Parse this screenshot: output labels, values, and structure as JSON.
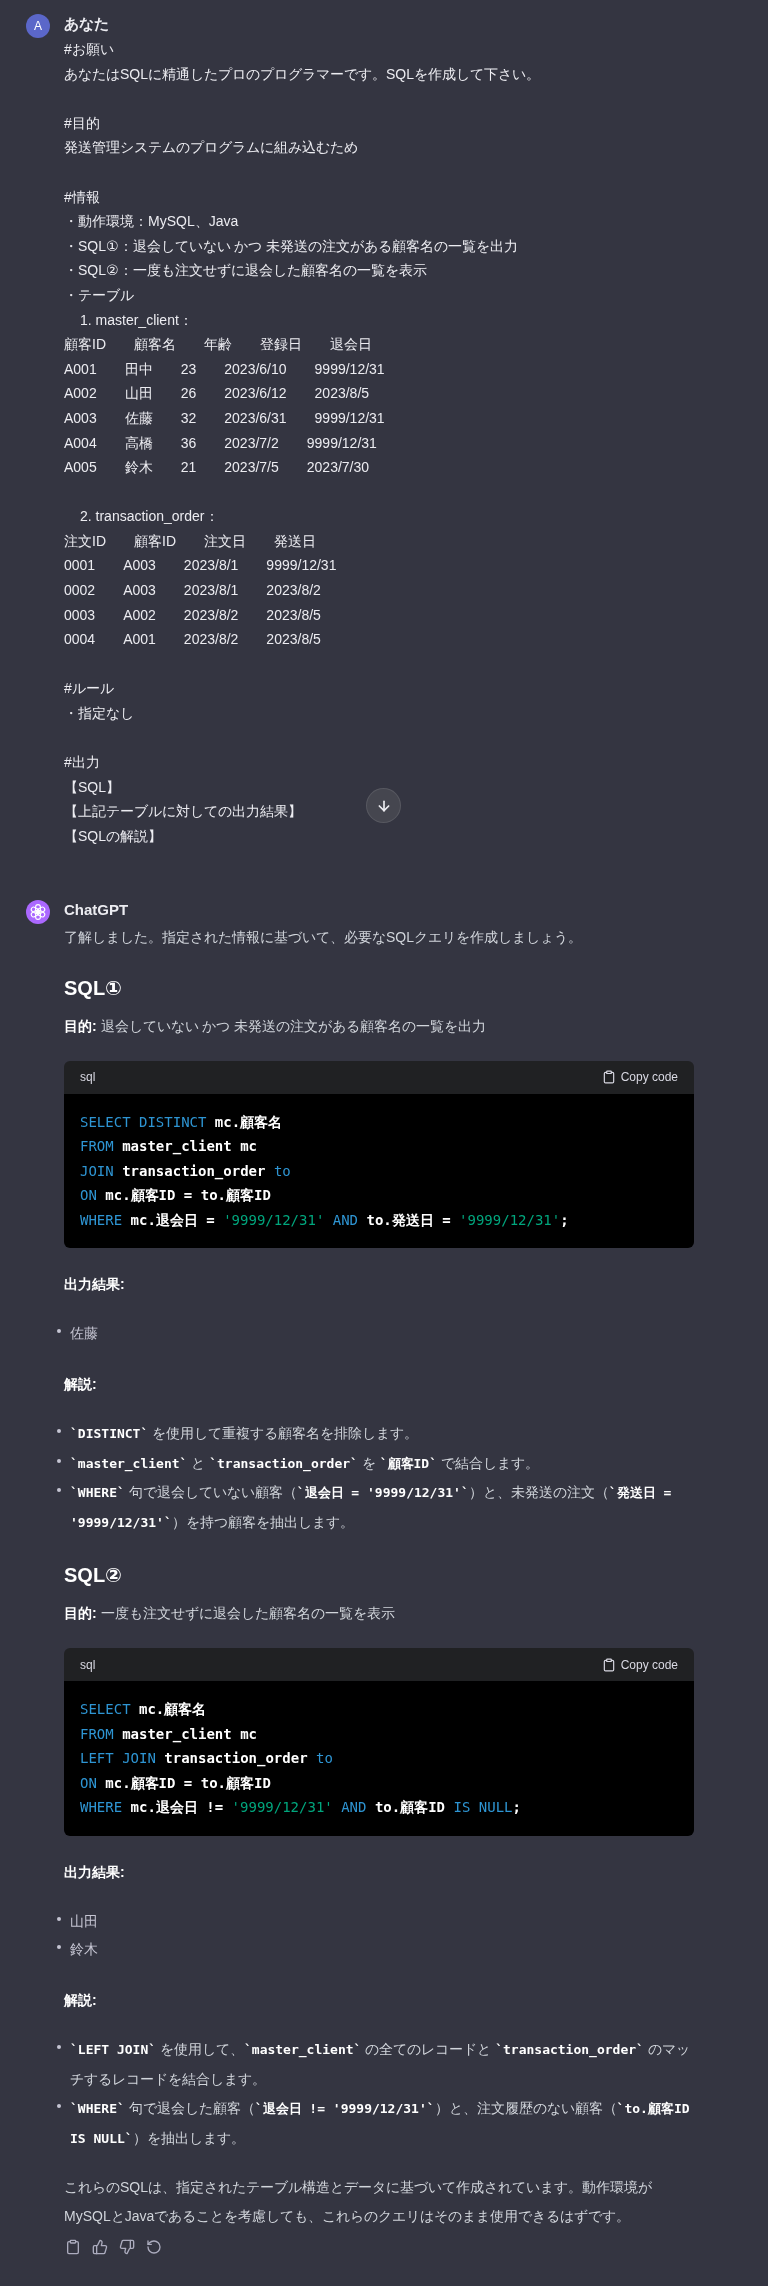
{
  "user_message": {
    "avatar": "A",
    "author": "あなた",
    "groups": [
      [
        {
          "kind": "text",
          "text": "#お願い"
        },
        {
          "kind": "text",
          "text": "あなたはSQLに精通したプロのプログラマーです。SQLを作成して下さい。"
        }
      ],
      [
        {
          "kind": "text",
          "text": "#目的"
        },
        {
          "kind": "text",
          "text": "発送管理システムのプログラムに組み込むため"
        }
      ],
      [
        {
          "kind": "text",
          "text": "#情報"
        },
        {
          "kind": "text",
          "text": "・動作環境：MySQL、Java"
        },
        {
          "kind": "text",
          "text": "・SQL①：退会していない かつ 未発送の注文がある顧客名の一覧を出力"
        },
        {
          "kind": "text",
          "text": "・SQL②：一度も注文せずに退会した顧客名の一覧を表示"
        },
        {
          "kind": "text",
          "text": "・テーブル"
        },
        {
          "kind": "table",
          "caption": "1. master_client：",
          "header": [
            "顧客ID",
            "顧客名",
            "年齢",
            "登録日",
            "退会日"
          ],
          "rows": [
            [
              "A001",
              "田中",
              "23",
              "2023/6/10",
              "9999/12/31"
            ],
            [
              "A002",
              "山田",
              "26",
              "2023/6/12",
              "2023/8/5"
            ],
            [
              "A003",
              "佐藤",
              "32",
              "2023/6/31",
              "9999/12/31"
            ],
            [
              "A004",
              "高橋",
              "36",
              "2023/7/2",
              "9999/12/31"
            ],
            [
              "A005",
              "鈴木",
              "21",
              "2023/7/5",
              "2023/7/30"
            ]
          ]
        }
      ],
      [
        {
          "kind": "table",
          "caption": "2. transaction_order：",
          "header": [
            "注文ID",
            "顧客ID",
            "注文日",
            "発送日"
          ],
          "rows": [
            [
              "0001",
              "A003",
              "2023/8/1",
              "9999/12/31"
            ],
            [
              "0002",
              "A003",
              "2023/8/1",
              "2023/8/2"
            ],
            [
              "0003",
              "A002",
              "2023/8/2",
              "2023/8/5"
            ],
            [
              "0004",
              "A001",
              "2023/8/2",
              "2023/8/5"
            ]
          ]
        }
      ],
      [
        {
          "kind": "text",
          "text": "#ルール"
        },
        {
          "kind": "text",
          "text": "・指定なし"
        }
      ],
      [
        {
          "kind": "text",
          "text": "#出力"
        },
        {
          "kind": "text",
          "text": "【SQL】"
        },
        {
          "kind": "text",
          "text": "【上記テーブルに対しての出力結果】"
        },
        {
          "kind": "text",
          "text": "【SQLの解説】"
        }
      ]
    ]
  },
  "assistant_message": {
    "author": "ChatGPT",
    "intro": "了解しました。指定された情報に基づいて、必要なSQLクエリを作成しましょう。",
    "sections": [
      {
        "heading": "SQL①",
        "purpose": "**目的:** 退会していない かつ 未発送の注文がある顧客名の一覧を出力",
        "code": {
          "language": "sql",
          "copy_label": "Copy code",
          "lines": [
            [
              {
                "kind": "keyword",
                "text": "SELECT DISTINCT"
              },
              {
                "kind": "plain",
                "text": " mc.顧客名"
              }
            ],
            [
              {
                "kind": "keyword",
                "text": "FROM"
              },
              {
                "kind": "plain",
                "text": " master_client mc"
              }
            ],
            [
              {
                "kind": "keyword",
                "text": "JOIN"
              },
              {
                "kind": "plain",
                "text": " transaction_order "
              },
              {
                "kind": "keyword",
                "text": "to"
              }
            ],
            [
              {
                "kind": "keyword",
                "text": "ON"
              },
              {
                "kind": "plain",
                "text": " mc.顧客ID = to.顧客ID"
              }
            ],
            [
              {
                "kind": "keyword",
                "text": "WHERE"
              },
              {
                "kind": "plain",
                "text": " mc.退会日 = "
              },
              {
                "kind": "string",
                "text": "'9999/12/31'"
              },
              {
                "kind": "keyword",
                "text": " AND "
              },
              {
                "kind": "plain",
                "text": "to.発送日 = "
              },
              {
                "kind": "string",
                "text": "'9999/12/31'"
              },
              {
                "kind": "plain",
                "text": ";"
              }
            ]
          ]
        },
        "result_label": "出力結果:",
        "results": [
          "佐藤"
        ],
        "explanation_label": "解説:",
        "explanations": [
          "**`DISTINCT`** を使用して重複する顧客名を排除します。",
          "**`master_client`** と **`transaction_order`** を **`顧客ID`** で結合します。",
          "**`WHERE`** 句で退会していない顧客（**`退会日 = '9999/12/31'`**）と、未発送の注文（**`発送日 = '9999/12/31'`**）を持つ顧客を抽出します。"
        ]
      },
      {
        "heading": "SQL②",
        "purpose": "**目的:** 一度も注文せずに退会した顧客名の一覧を表示",
        "code": {
          "language": "sql",
          "copy_label": "Copy code",
          "lines": [
            [
              {
                "kind": "keyword",
                "text": "SELECT"
              },
              {
                "kind": "plain",
                "text": " mc.顧客名"
              }
            ],
            [
              {
                "kind": "keyword",
                "text": "FROM"
              },
              {
                "kind": "plain",
                "text": " master_client mc"
              }
            ],
            [
              {
                "kind": "keyword",
                "text": "LEFT JOIN"
              },
              {
                "kind": "plain",
                "text": " transaction_order "
              },
              {
                "kind": "keyword",
                "text": "to"
              }
            ],
            [
              {
                "kind": "keyword",
                "text": "ON"
              },
              {
                "kind": "plain",
                "text": " mc.顧客ID = to.顧客ID"
              }
            ],
            [
              {
                "kind": "keyword",
                "text": "WHERE"
              },
              {
                "kind": "plain",
                "text": " mc.退会日 != "
              },
              {
                "kind": "string",
                "text": "'9999/12/31'"
              },
              {
                "kind": "keyword",
                "text": " AND "
              },
              {
                "kind": "plain",
                "text": "to.顧客ID "
              },
              {
                "kind": "keyword",
                "text": "IS NULL"
              },
              {
                "kind": "plain",
                "text": ";"
              }
            ]
          ]
        },
        "result_label": "出力結果:",
        "results": [
          "山田",
          "鈴木"
        ],
        "explanation_label": "解説:",
        "explanations": [
          "**`LEFT JOIN`** を使用して、**`master_client`** の全てのレコードと **`transaction_order`** のマッチするレコードを結合します。",
          "**`WHERE`** 句で退会した顧客（**`退会日 != '9999/12/31'`**）と、注文履歴のない顧客（**`to.顧客ID IS NULL`**）を抽出します。"
        ]
      }
    ],
    "closing": "これらのSQLは、指定されたテーブル構造とデータに基づいて作成されています。動作環境がMySQLとJavaであることを考慮しても、これらのクエリはそのまま使用できるはずです。"
  }
}
